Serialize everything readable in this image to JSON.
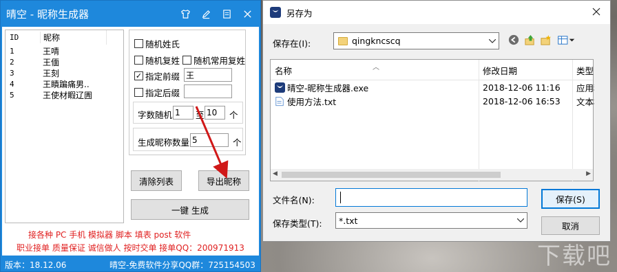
{
  "app": {
    "title": "晴空 - 昵称生成器",
    "list": {
      "col_id": "ID",
      "col_name": "昵称",
      "rows": [
        {
          "id": "1",
          "name": "王啨"
        },
        {
          "id": "2",
          "name": "王偭"
        },
        {
          "id": "3",
          "name": "王刻"
        },
        {
          "id": "4",
          "name": "王瞔蹁痛男.."
        },
        {
          "id": "5",
          "name": "王使材睱辽圊"
        }
      ]
    },
    "options": {
      "random_surname": "随机姓氏",
      "random_compound": "随机复姓",
      "random_common_compound": "随机常用复姓",
      "prefix_label": "指定前缀",
      "prefix_value": "王",
      "prefix_checked": true,
      "suffix_label": "指定后缀",
      "suffix_value": "",
      "length_label": "字数随机",
      "length_min": "1",
      "length_to": "至",
      "length_max": "10",
      "length_unit": "个",
      "count_label": "生成昵称数量",
      "count_value": "5",
      "count_unit": "个"
    },
    "buttons": {
      "clear": "清除列表",
      "export": "导出昵称",
      "generate": "一键 生成"
    },
    "promo_line1": "接各种 PC 手机 模拟器 脚本 填表 post 软件",
    "promo_line2": "职业接单 质量保证 诚信做人 按时交单  接单QQ：200971913",
    "footer_version": "版本：18.12.06",
    "footer_group": "晴空-免费软件分享QQ群：725154503",
    "accent_color": "#1e88dc",
    "promo_color": "#e02020"
  },
  "dialog": {
    "title": "另存为",
    "save_in_label": "保存在(I):",
    "save_in_value": "qingkncscq",
    "columns": {
      "name": "名称",
      "date": "修改日期",
      "type": "类型"
    },
    "files": [
      {
        "name": "晴空-昵称生成器.exe",
        "date": "2018-12-06 11:16",
        "type": "应用程序",
        "icon": "app-icon"
      },
      {
        "name": "使用方法.txt",
        "date": "2018-12-06 16:53",
        "type": "文本格式",
        "icon": "text-file-icon"
      }
    ],
    "filename_label": "文件名(N):",
    "filename_value": "",
    "filetype_label": "保存类型(T):",
    "filetype_value": "*.txt",
    "save_button": "保存(S)",
    "cancel_button": "取消",
    "accent_color": "#0078d7"
  }
}
